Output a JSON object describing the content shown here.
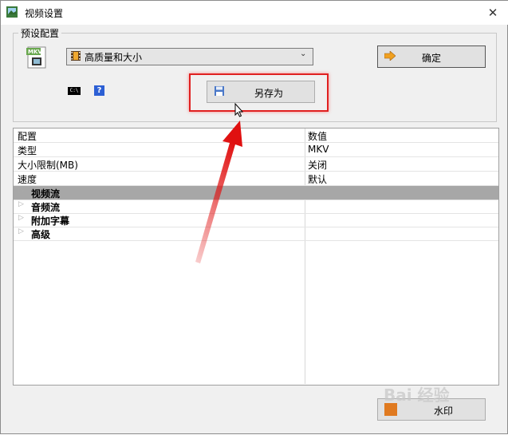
{
  "window": {
    "title": "视频设置",
    "close_glyph": "✕"
  },
  "preset_group": {
    "label": "预设配置",
    "selected_preset": "高质量和大小",
    "ok_label": "确定",
    "save_as_label": "另存为",
    "cmd_icon_text": "C:\\",
    "help_icon_text": "?"
  },
  "table": {
    "header": {
      "name": "配置",
      "value": "数值"
    },
    "rows": [
      {
        "name": "类型",
        "value": "MKV"
      },
      {
        "name": "大小限制(MB)",
        "value": "关闭"
      },
      {
        "name": "速度",
        "value": "默认"
      }
    ],
    "categories": [
      {
        "name": "视频流",
        "selected": true
      },
      {
        "name": "音频流",
        "selected": false
      },
      {
        "name": "附加字幕",
        "selected": false
      },
      {
        "name": "高级",
        "selected": false
      }
    ]
  },
  "bottom_button": {
    "label": "水印"
  },
  "colors": {
    "highlight": "#e02020",
    "selected_row": "#a7a7a7",
    "help_icon": "#2c5fd4"
  },
  "icons": [
    "app-icon",
    "mkv-file-icon",
    "film-icon",
    "chevron-down-icon",
    "arrow-right-icon",
    "cmd-icon",
    "help-icon",
    "floppy-disk-icon",
    "mouse-cursor-icon",
    "watermark-icon"
  ]
}
